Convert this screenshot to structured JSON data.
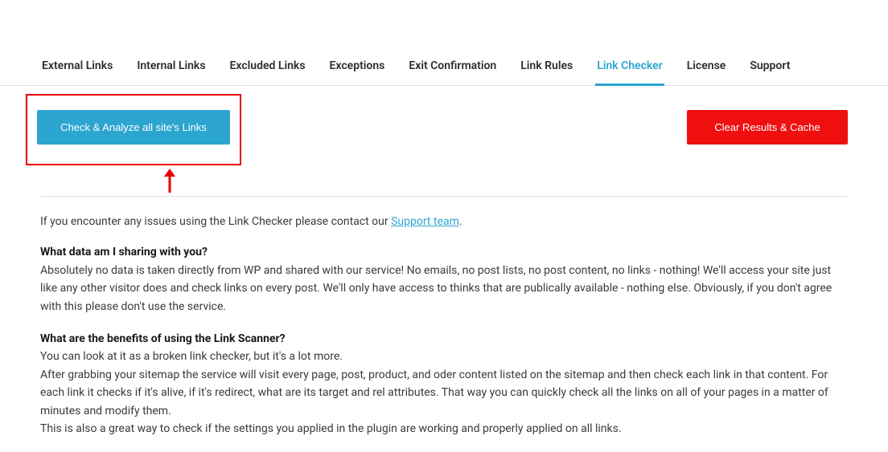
{
  "tabs": [
    {
      "label": "External Links"
    },
    {
      "label": "Internal Links"
    },
    {
      "label": "Excluded Links"
    },
    {
      "label": "Exceptions"
    },
    {
      "label": "Exit Confirmation"
    },
    {
      "label": "Link Rules"
    },
    {
      "label": "Link Checker"
    },
    {
      "label": "License"
    },
    {
      "label": "Support"
    }
  ],
  "buttons": {
    "check_analyze": "Check & Analyze all site's Links",
    "clear_cache": "Clear Results & Cache"
  },
  "intro": {
    "text_before_link": "If you encounter any issues using the Link Checker please contact our ",
    "support_link": "Support team",
    "text_after_link": "."
  },
  "sections": [
    {
      "heading": "What data am I sharing with you?",
      "body": "Absolutely no data is taken directly from WP and shared with our service! No emails, no post lists, no post content, no links - nothing! We'll access your site just like any other visitor does and check links on every post. We'll only have access to thinks that are publically available - nothing else. Obviously, if you don't agree with this please don't use the service."
    },
    {
      "heading": "What are the benefits of using the Link Scanner?",
      "body_lines": [
        "You can look at it as a broken link checker, but it's a lot more.",
        "After grabbing your sitemap the service will visit every page, post, product, and oder content listed on the sitemap and then check each link in that content. For each link it checks if it's alive, if it's redirect, what are its target and rel attributes. That way you can quickly check all the links on all of your pages in a matter of minutes and modify them.",
        "This is also a great way to check if the settings you applied in the plugin are working and properly applied on all links."
      ]
    }
  ]
}
